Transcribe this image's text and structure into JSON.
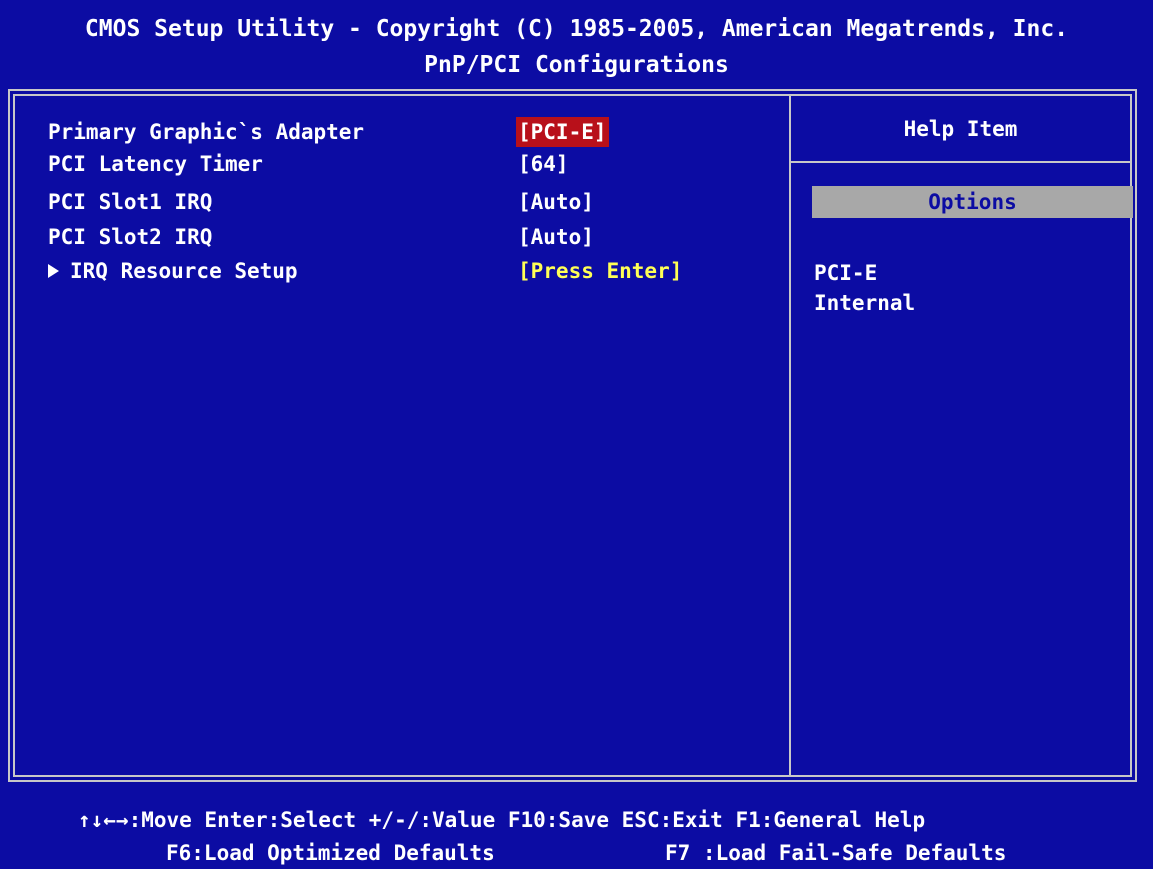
{
  "header": {
    "title": "CMOS Setup Utility - Copyright (C) 1985-2005, American Megatrends, Inc.",
    "subtitle": "PnP/PCI Configurations"
  },
  "settings": [
    {
      "label": "Primary Graphic`s Adapter",
      "value": "[PCI-E]"
    },
    {
      "label": "PCI Latency Timer",
      "value": "[64]"
    },
    {
      "label": "PCI Slot1 IRQ",
      "value": "[Auto]"
    },
    {
      "label": "PCI Slot2 IRQ",
      "value": "[Auto]"
    },
    {
      "label": "IRQ Resource Setup",
      "value": "[Press Enter]"
    }
  ],
  "help": {
    "title": "Help Item",
    "options_header": "Options",
    "options": [
      "PCI-E",
      "Internal"
    ]
  },
  "footer": {
    "line1": "↑↓←→:Move  Enter:Select  +/-/:Value  F10:Save  ESC:Exit  F1:General Help",
    "line2_left": "F6:Load Optimized Defaults",
    "line2_right": "F7 :Load Fail-Safe Defaults"
  },
  "colors": {
    "background": "#0c0ca3",
    "text": "#ffffff",
    "highlight": "#b8101a",
    "submenu_value": "#ffff55",
    "options_bar": "#a8a8a8"
  },
  "icons": {
    "submenu": "submenu-arrow-icon"
  }
}
